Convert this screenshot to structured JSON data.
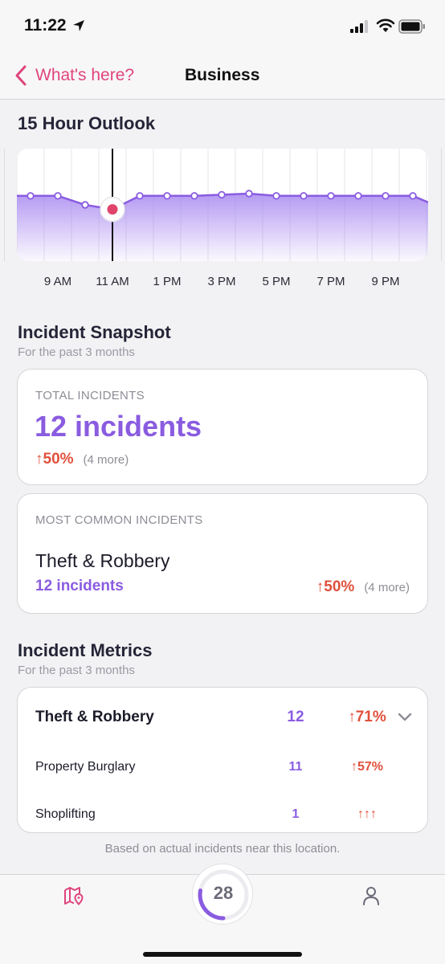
{
  "status_bar": {
    "time": "11:22"
  },
  "nav": {
    "back_label": "What's here?",
    "title": "Business"
  },
  "outlook": {
    "title": "15 Hour Outlook",
    "hour_labels": [
      "9 AM",
      "11 AM",
      "1 PM",
      "3 PM",
      "5 PM",
      "7 PM",
      "9 PM"
    ],
    "current_hour_label": "11 AM"
  },
  "chart_data": {
    "type": "area",
    "title": "15 Hour Outlook",
    "x_tick_labels": [
      "9 AM",
      "11 AM",
      "1 PM",
      "3 PM",
      "5 PM",
      "7 PM",
      "9 PM"
    ],
    "hourly_points": 15,
    "series": [
      {
        "values": [
          0.58,
          0.58,
          0.5,
          0.46,
          0.58,
          0.58,
          0.58,
          0.59,
          0.6,
          0.58,
          0.58,
          0.58,
          0.58,
          0.58,
          0.58
        ]
      }
    ],
    "highlighted_point_index": 3,
    "ylim": [
      0,
      1
    ],
    "grid": "vertical",
    "fill_color": "#a787f0",
    "line_color": "#8a5ce0",
    "marker_color": "#e0446a"
  },
  "snapshot": {
    "title": "Incident Snapshot",
    "subtitle": "For the past 3 months",
    "total": {
      "caption": "TOTAL INCIDENTS",
      "count": "12 incidents",
      "delta": "↑50%",
      "more": "(4 more)"
    },
    "most_common": {
      "caption": "MOST COMMON INCIDENTS",
      "name": "Theft & Robbery",
      "count": "12 incidents",
      "delta": "↑50%",
      "more": "(4 more)"
    }
  },
  "metrics": {
    "title": "Incident Metrics",
    "subtitle": "For the past 3 months",
    "rows": [
      {
        "name": "Theft & Robbery",
        "value": "12",
        "delta": "↑71%"
      },
      {
        "name": "Property Burglary",
        "value": "11",
        "delta": "↑57%"
      },
      {
        "name": "Shoplifting",
        "value": "1",
        "delta": "↑↑↑"
      }
    ]
  },
  "footnote": "Based on actual incidents near this location.",
  "tab_bar": {
    "score": "28",
    "score_progress": 0.28,
    "map_icon": "map-pin-icon",
    "user_icon": "user-icon"
  },
  "colors": {
    "accent_pink": "#e0447c",
    "accent_purple": "#8a5ce0",
    "delta_red": "#e0503c"
  }
}
